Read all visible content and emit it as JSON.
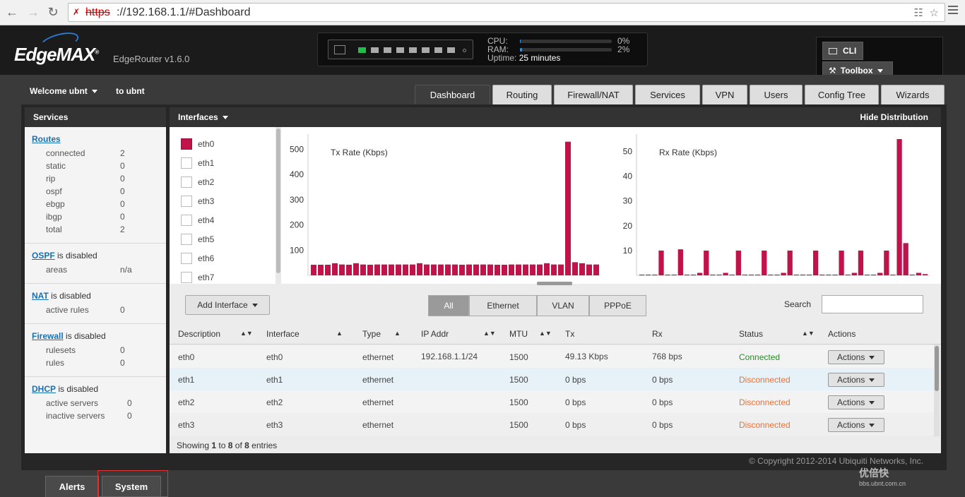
{
  "browser": {
    "url_scheme": "https",
    "url_rest": "://192.168.1.1/#Dashboard"
  },
  "header": {
    "logo": "EdgeMAX",
    "version": "EdgeRouter v1.6.0",
    "cpu_label": "CPU:",
    "cpu_value": "0%",
    "cpu_fraction": 0.0,
    "ram_label": "RAM:",
    "ram_value": "2%",
    "ram_fraction": 0.02,
    "uptime_label": "Uptime:",
    "uptime_value": "25 minutes",
    "cli_label": "CLI",
    "toolbox_label": "Toolbox"
  },
  "welcome": {
    "text": "Welcome ubnt",
    "to_user": "to ubnt"
  },
  "tabs": [
    "Dashboard",
    "Routing",
    "Firewall/NAT",
    "Services",
    "VPN",
    "Users",
    "Config Tree",
    "Wizards"
  ],
  "sidebar": {
    "title": "Services",
    "routes": {
      "title": "Routes",
      "rows": [
        {
          "k": "connected",
          "v": "2"
        },
        {
          "k": "static",
          "v": "0"
        },
        {
          "k": "rip",
          "v": "0"
        },
        {
          "k": "ospf",
          "v": "0"
        },
        {
          "k": "ebgp",
          "v": "0"
        },
        {
          "k": "ibgp",
          "v": "0"
        },
        {
          "k": "total",
          "v": "2"
        }
      ]
    },
    "ospf": {
      "title": "OSPF",
      "status": " is disabled",
      "rows": [
        {
          "k": "areas",
          "v": "n/a"
        }
      ]
    },
    "nat": {
      "title": "NAT",
      "status": " is disabled",
      "rows": [
        {
          "k": "active rules",
          "v": "0"
        }
      ]
    },
    "firewall": {
      "title": "Firewall",
      "status": " is disabled",
      "rows": [
        {
          "k": "rulesets",
          "v": "0"
        },
        {
          "k": "rules",
          "v": "0"
        }
      ]
    },
    "dhcp": {
      "title": "DHCP",
      "status": " is disabled",
      "rows": [
        {
          "k": "active servers",
          "v": "0"
        },
        {
          "k": "inactive servers",
          "v": "0"
        }
      ]
    }
  },
  "interfaces_panel": {
    "title": "Interfaces",
    "hide_label": "Hide Distribution",
    "list": [
      "eth0",
      "eth1",
      "eth2",
      "eth3",
      "eth4",
      "eth5",
      "eth6",
      "eth7"
    ],
    "selected": "eth0",
    "series_color": "#c0134a"
  },
  "chart_data": [
    {
      "type": "bar",
      "title": "Tx Rate (Kbps)",
      "ylim": [
        0,
        560
      ],
      "yticks": [
        100,
        200,
        300,
        400,
        500
      ],
      "values": [
        42,
        42,
        42,
        48,
        43,
        42,
        48,
        43,
        42,
        43,
        43,
        43,
        43,
        43,
        43,
        48,
        43,
        43,
        43,
        43,
        43,
        42,
        43,
        43,
        43,
        43,
        42,
        42,
        43,
        43,
        43,
        43,
        43,
        48,
        43,
        43,
        530,
        52,
        48,
        43,
        43
      ]
    },
    {
      "type": "bar",
      "title": "Rx Rate (Kbps)",
      "ylim": [
        0,
        57
      ],
      "yticks": [
        10,
        20,
        30,
        40,
        50
      ],
      "values": [
        0.3,
        0.3,
        0.3,
        10,
        0.3,
        0.3,
        10.5,
        0.3,
        0.3,
        1,
        10,
        0.3,
        0.3,
        1,
        0.3,
        10,
        0.3,
        0.3,
        0.3,
        10,
        0.3,
        0.3,
        1,
        10,
        0.3,
        0.3,
        0.3,
        10,
        0.3,
        0.3,
        0.3,
        10,
        0.3,
        1,
        10,
        0.3,
        0.3,
        1,
        10,
        0.3,
        55,
        13,
        0.3,
        1,
        0.5
      ]
    }
  ],
  "table": {
    "add_interface": "Add Interface",
    "filters": [
      "All",
      "Ethernet",
      "VLAN",
      "PPPoE"
    ],
    "active_filter": "All",
    "search_label": "Search",
    "search_value": "",
    "columns": [
      "Description",
      "Interface",
      "Type",
      "IP Addr",
      "MTU",
      "Tx",
      "Rx",
      "Status",
      "Actions"
    ],
    "rows": [
      {
        "description": "eth0",
        "interface": "eth0",
        "type": "ethernet",
        "ip": "192.168.1.1/24",
        "mtu": "1500",
        "tx": "49.13 Kbps",
        "rx": "768 bps",
        "status": "Connected",
        "action": "Actions"
      },
      {
        "description": "eth1",
        "interface": "eth1",
        "type": "ethernet",
        "ip": "",
        "mtu": "1500",
        "tx": "0 bps",
        "rx": "0 bps",
        "status": "Disconnected",
        "action": "Actions"
      },
      {
        "description": "eth2",
        "interface": "eth2",
        "type": "ethernet",
        "ip": "",
        "mtu": "1500",
        "tx": "0 bps",
        "rx": "0 bps",
        "status": "Disconnected",
        "action": "Actions"
      },
      {
        "description": "eth3",
        "interface": "eth3",
        "type": "ethernet",
        "ip": "",
        "mtu": "1500",
        "tx": "0 bps",
        "rx": "0 bps",
        "status": "Disconnected",
        "action": "Actions"
      }
    ],
    "showing_prefix": "Showing ",
    "showing_from": "1",
    "showing_mid": " to ",
    "showing_to": "8",
    "showing_of": " of ",
    "showing_total": "8",
    "showing_suffix": " entries"
  },
  "footer": {
    "copyright": "© Copyright 2012-2014 Ubiquiti Networks, Inc.",
    "alerts_tab": "Alerts",
    "system_tab": "System",
    "watermark": "优倍快",
    "watermark_sub": "bbs.ubnt.com.cn"
  }
}
